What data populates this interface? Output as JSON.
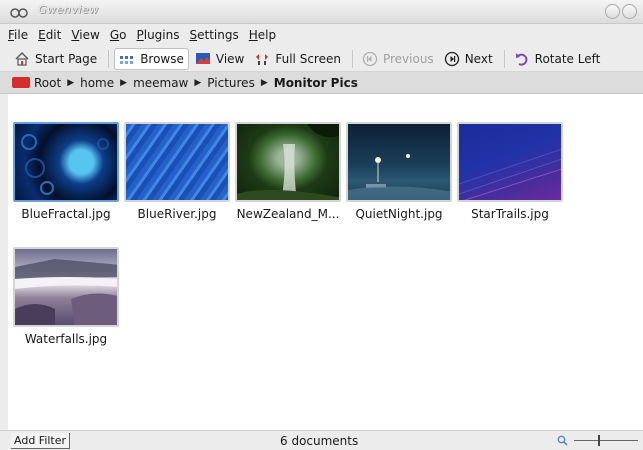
{
  "window": {
    "title": "Gwenview"
  },
  "menu": [
    "File",
    "Edit",
    "View",
    "Go",
    "Plugins",
    "Settings",
    "Help"
  ],
  "toolbar": {
    "start_page": "Start Page",
    "browse": "Browse",
    "view": "View",
    "full_screen": "Full Screen",
    "previous": "Previous",
    "next": "Next",
    "rotate_left": "Rotate Left"
  },
  "breadcrumb": [
    "Root",
    "home",
    "meemaw",
    "Pictures",
    "Monitor Pics"
  ],
  "thumbnails": [
    {
      "label": "BlueFractal.jpg",
      "icon": "blue-fractal-thumbnail",
      "selected": true
    },
    {
      "label": "BlueRiver.jpg",
      "icon": "blue-river-thumbnail",
      "selected": false
    },
    {
      "label": "NewZealand_M...",
      "icon": "new-zealand-thumbnail",
      "selected": false
    },
    {
      "label": "QuietNight.jpg",
      "icon": "quiet-night-thumbnail",
      "selected": false
    },
    {
      "label": "StarTrails.jpg",
      "icon": "star-trails-thumbnail",
      "selected": false
    },
    {
      "label": "Waterfalls.jpg",
      "icon": "waterfalls-thumbnail",
      "selected": false
    }
  ],
  "status": {
    "add_filter": "Add Filter",
    "doc_count": "6 documents"
  },
  "colors": {
    "accent": "#6b9fd8",
    "folder": "#d52c2c"
  }
}
